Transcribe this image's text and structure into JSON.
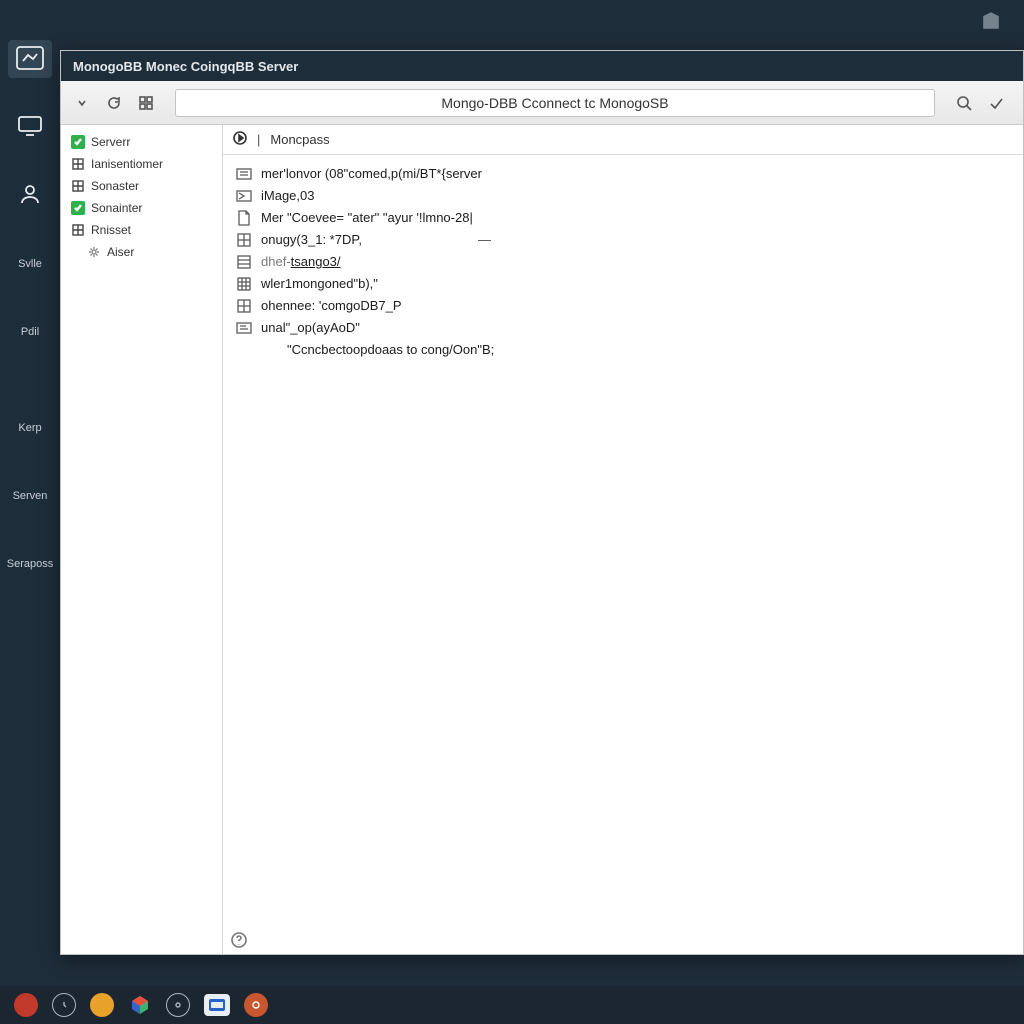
{
  "window": {
    "title": "MonogoBB Monec CoingqBB Server",
    "address": "Mongo-DBB Cconnect tc MonogoSB"
  },
  "activity": {
    "items": [
      {
        "label": ""
      },
      {
        "label": ""
      },
      {
        "label": ""
      },
      {
        "label": "Svlle"
      },
      {
        "label": "Pdil"
      },
      {
        "label": "Kerp"
      },
      {
        "label": "Serven"
      },
      {
        "label": "Seraposs"
      }
    ]
  },
  "tree": {
    "items": [
      {
        "label": "Serverr",
        "icon": "green"
      },
      {
        "label": "Ianisentiomer",
        "icon": "box"
      },
      {
        "label": "Sonaster",
        "icon": "box"
      },
      {
        "label": "Sonainter",
        "icon": "green"
      },
      {
        "label": "Rnisset",
        "icon": "box"
      },
      {
        "label": "Aiser",
        "icon": "gear",
        "indent": true
      }
    ]
  },
  "editor": {
    "tab": "Moncpass",
    "lines": [
      {
        "text": "mer'lonvor (08\"comed,p(mi/BT*{server",
        "kind": "code"
      },
      {
        "text": "iMage,03",
        "kind": "code"
      },
      {
        "text": "Mer \"Coevee= \"ater\" \"ayur '!lmno-28|",
        "kind": "code-alt"
      },
      {
        "text": "onugy(3_1: *7DP,",
        "kind": "code",
        "dash": true
      },
      {
        "text": "dhef-tsango3/",
        "kind": "code"
      },
      {
        "text": "wler1mongoned\"b),\"",
        "kind": "code"
      },
      {
        "text": "ohennee: 'comgoDB7_P",
        "kind": "code"
      },
      {
        "text": "unal\"_op(ayAoD\"",
        "kind": "code"
      },
      {
        "text": "\"Ccncbectoopdoaas to cong/Oon\"B;",
        "kind": "indent"
      }
    ]
  },
  "colors": {
    "bg": "#1e2d3a",
    "accent_green": "#2eb04a"
  },
  "taskbar": {
    "icons": [
      {
        "name": "app-red",
        "color": "#c0392b"
      },
      {
        "name": "app-clock",
        "color": "#1b2631",
        "ring": true
      },
      {
        "name": "app-amber",
        "color": "#e8a12a"
      },
      {
        "name": "app-files",
        "color": "#3bb273",
        "square": true,
        "multi": true
      },
      {
        "name": "app-ring2",
        "color": "#1b2631",
        "ring": true
      },
      {
        "name": "app-term",
        "color": "#2563c9",
        "square": true
      },
      {
        "name": "app-orange",
        "color": "#c8572f"
      }
    ]
  }
}
